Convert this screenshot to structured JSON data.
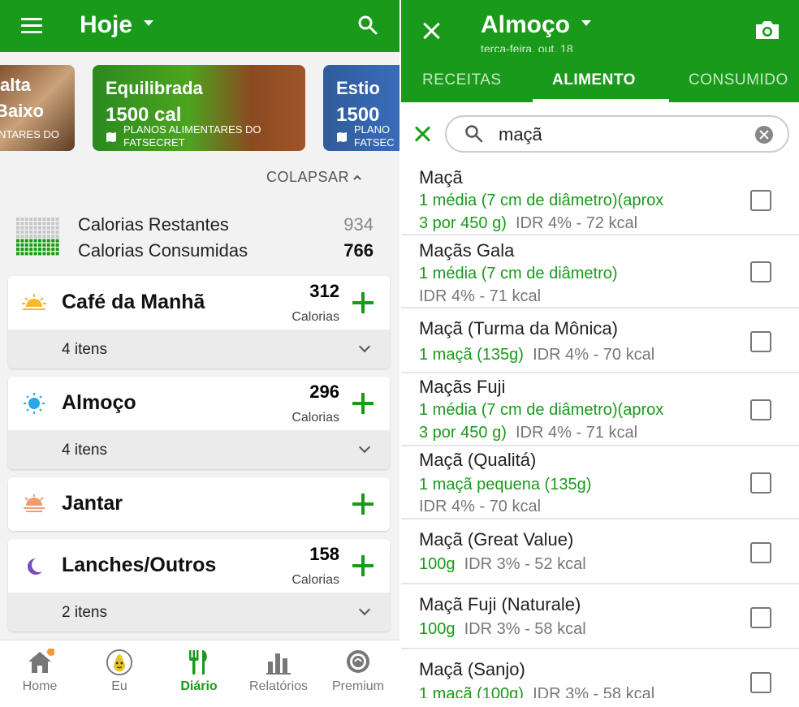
{
  "left": {
    "header": {
      "title": "Hoje"
    },
    "banners": [
      {
        "line1": "alta",
        "line2": "Baixo",
        "footer": "NTARES DO"
      },
      {
        "line1": "Equilibrada",
        "line2": "1500 cal",
        "footer1": "PLANOS ALIMENTARES DO",
        "footer2": "FATSECRET"
      },
      {
        "line1": "Estio",
        "line2": "1500",
        "footer1": "PLANO",
        "footer2": "FATSEC"
      }
    ],
    "collapse_label": "COLAPSAR",
    "calories": {
      "remaining_label": "Calorias Restantes",
      "remaining_value": "934",
      "consumed_label": "Calorias Consumidas",
      "consumed_value": "766"
    },
    "meals": [
      {
        "name": "Café da Manhã",
        "calories": "312",
        "calories_label": "Calorias",
        "items": "4 itens"
      },
      {
        "name": "Almoço",
        "calories": "296",
        "calories_label": "Calorias",
        "items": "4 itens"
      },
      {
        "name": "Jantar"
      },
      {
        "name": "Lanches/Outros",
        "calories": "158",
        "calories_label": "Calorias",
        "items": "2 itens"
      }
    ],
    "nav": [
      {
        "label": "Home",
        "icon": "home-icon"
      },
      {
        "label": "Eu",
        "icon": "pear-avatar-icon"
      },
      {
        "label": "Diário",
        "icon": "cutlery-icon"
      },
      {
        "label": "Relatórios",
        "icon": "bar-chart-icon"
      },
      {
        "label": "Premium",
        "icon": "premium-icon"
      }
    ]
  },
  "right": {
    "header": {
      "title": "Almoço",
      "subtitle": "terça-feira, out. 18"
    },
    "tabs": [
      "RECEITAS",
      "ALIMENTO",
      "CONSUMIDO"
    ],
    "active_tab": "ALIMENTO",
    "search": {
      "value": "maçã"
    },
    "results": [
      {
        "name": "Maçã",
        "serving": "1 média (7 cm de diâmetro)(aprox",
        "serving2": "3 por 450 g)",
        "info": "IDR 4% - 72 kcal"
      },
      {
        "name": "Maçãs Gala",
        "serving": "1 média (7 cm de diâmetro)",
        "info": "IDR 4% - 71 kcal"
      },
      {
        "name": "Maçã (Turma da Mônica)",
        "serving": "1 maçã (135g)",
        "info": "IDR 4% - 70 kcal"
      },
      {
        "name": "Maçãs Fuji",
        "serving": "1 média (7 cm de diâmetro)(aprox",
        "serving2": "3 por 450 g)",
        "info": "IDR 4% - 71 kcal"
      },
      {
        "name": "Maçã (Qualitá)",
        "serving": "1 maçã pequena (135g)",
        "info": "IDR 4% - 70 kcal"
      },
      {
        "name": "Maçã (Great Value)",
        "serving": "100g",
        "info": "IDR 3% - 52 kcal"
      },
      {
        "name": "Maçã Fuji (Naturale)",
        "serving": "100g",
        "info": "IDR 3% - 58 kcal"
      },
      {
        "name": "Maçã (Sanjo)",
        "serving": "1 maçã (100g)",
        "info": "IDR 3% - 58 kcal"
      }
    ]
  },
  "colors": {
    "brand_green": "#1a9a1a",
    "gray_text": "#777777"
  }
}
